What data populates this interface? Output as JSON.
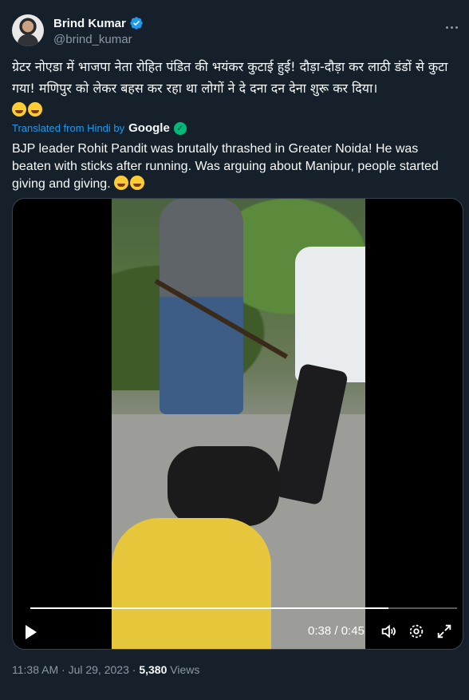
{
  "author": {
    "name": "Brind Kumar",
    "handle": "@brind_kumar"
  },
  "tweet": {
    "text_hindi": "ग्रेटर नोएडा में भाजपा नेता रोहित पंडित की भयंकर कुटाई हुई! दौड़ा-दौड़ा कर लाठी डंडों से कुटा गया! मणिपुर को लेकर बहस कर रहा था लोगों ने दे दना दन देना शुरू कर दिया।",
    "translated_from": "Translated from Hindi by",
    "translator": "Google",
    "translation": "BJP leader Rohit Pandit was brutally thrashed in Greater Noida! He was beaten with sticks after running. Was arguing about Manipur, people started giving and giving."
  },
  "video": {
    "current_time": "0:38",
    "duration": "0:45",
    "progress": 0.84
  },
  "footer": {
    "time": "11:38 AM",
    "separator": " · ",
    "date": "Jul 29, 2023",
    "views_count": "5,380",
    "views_label": "Views"
  },
  "colors": {
    "background": "#15202b",
    "accent": "#1d9bf0",
    "verified": "#1d9bf0",
    "muted": "#8b98a5"
  }
}
